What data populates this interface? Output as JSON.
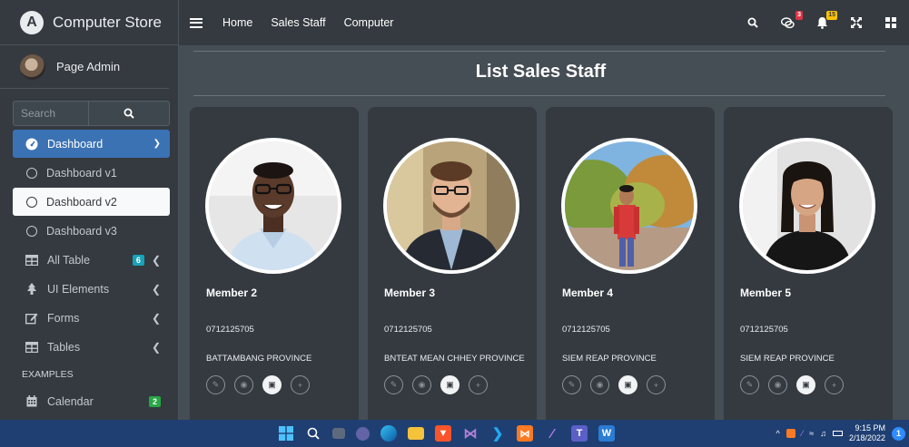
{
  "brand": {
    "logo_letter": "A",
    "name": "Computer Store"
  },
  "user": {
    "name": "Page Admin"
  },
  "search": {
    "placeholder": "Search"
  },
  "sidebar": {
    "items": [
      {
        "label": "Dashboard",
        "icon": "tachometer-icon"
      },
      {
        "label": "Dashboard v1",
        "icon": "circle-icon"
      },
      {
        "label": "Dashboard v2",
        "icon": "circle-icon"
      },
      {
        "label": "Dashboard v3",
        "icon": "circle-icon"
      },
      {
        "label": "All Table",
        "icon": "table-icon",
        "badge": "6"
      },
      {
        "label": "UI Elements",
        "icon": "tree-icon"
      },
      {
        "label": "Forms",
        "icon": "edit-icon"
      },
      {
        "label": "Tables",
        "icon": "table-icon"
      }
    ],
    "header": "EXAMPLES",
    "calendar": {
      "label": "Calendar",
      "icon": "calendar-icon",
      "badge": "2"
    }
  },
  "topnav": {
    "links": [
      "Home",
      "Sales Staff",
      "Computer"
    ]
  },
  "topbar_badges": {
    "messages": "3",
    "notifications": "15"
  },
  "main": {
    "title": "List Sales Staff",
    "members": [
      {
        "name": "Member 2",
        "phone": "0712125705",
        "address": "BATTAMBANG PROVINCE"
      },
      {
        "name": "Member 3",
        "phone": "0712125705",
        "address": "BNTEAT MEAN CHHEY PROVINCE"
      },
      {
        "name": "Member 4",
        "phone": "0712125705",
        "address": "SIEM REAP PROVINCE"
      },
      {
        "name": "Member 5",
        "phone": "0712125705",
        "address": "SIEM REAP PROVINCE"
      }
    ]
  },
  "taskbar": {
    "time": "9:15 PM",
    "date": "2/18/2022",
    "notification_count": "1"
  },
  "colors": {
    "sidebar_bg": "#343a40",
    "content_bg": "#454d55",
    "active_nav": "#3b72b4",
    "taskbar": "#1f3f72"
  }
}
